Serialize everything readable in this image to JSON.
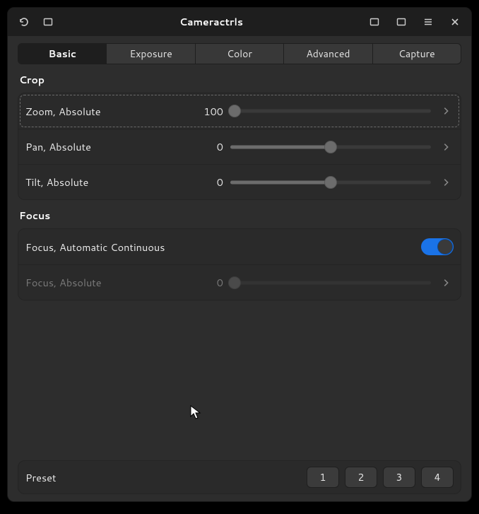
{
  "header": {
    "title": "Cameractrls"
  },
  "tabs": [
    {
      "label": "Basic",
      "active": true
    },
    {
      "label": "Exposure",
      "active": false
    },
    {
      "label": "Color",
      "active": false
    },
    {
      "label": "Advanced",
      "active": false
    },
    {
      "label": "Capture",
      "active": false
    }
  ],
  "sections": {
    "crop": {
      "title": "Crop",
      "rows": [
        {
          "label": "Zoom, Absolute",
          "value": "100",
          "thumb_pct": 2,
          "fill_pct": 0,
          "focused": true
        },
        {
          "label": "Pan, Absolute",
          "value": "0",
          "thumb_pct": 50,
          "fill_pct": 50,
          "focused": false
        },
        {
          "label": "Tilt, Absolute",
          "value": "0",
          "thumb_pct": 50,
          "fill_pct": 50,
          "focused": false
        }
      ]
    },
    "focus": {
      "title": "Focus",
      "toggle": {
        "label": "Focus, Automatic Continuous",
        "on": true
      },
      "slider": {
        "label": "Focus, Absolute",
        "value": "0",
        "thumb_pct": 2,
        "fill_pct": 0,
        "disabled": true
      }
    }
  },
  "preset": {
    "label": "Preset",
    "buttons": [
      "1",
      "2",
      "3",
      "4"
    ]
  }
}
